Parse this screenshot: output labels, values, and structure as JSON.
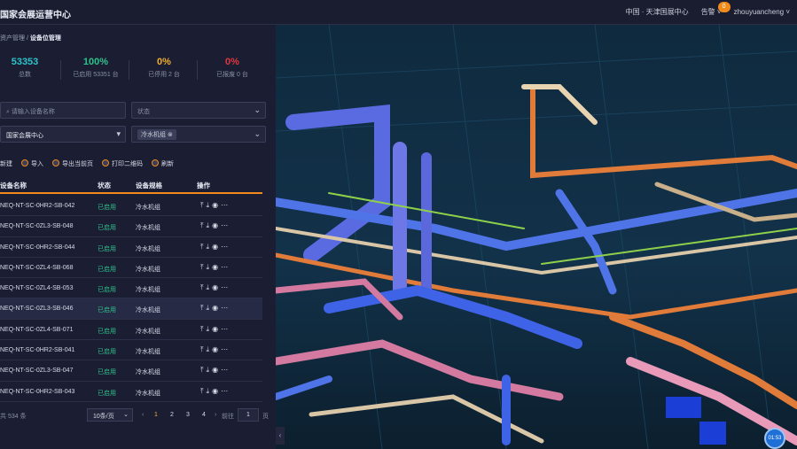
{
  "header": {
    "title": "国家会展运营中心",
    "region": "中国 · 天津国展中心",
    "alarm_label": "告警",
    "alarm_count": "0",
    "username": "zhouyuancheng"
  },
  "breadcrumb": {
    "parent": "资产管理",
    "current": "设备位管理"
  },
  "stats": [
    {
      "value": "53353",
      "label": "总数",
      "color": "#2ec2c8"
    },
    {
      "value": "100%",
      "label": "已启用 53351 台",
      "color": "#2ec28b"
    },
    {
      "value": "0%",
      "label": "已停用 2 台",
      "color": "#f0b02a"
    },
    {
      "value": "0%",
      "label": "已报废 0 台",
      "color": "#e0363a"
    }
  ],
  "filters": {
    "search_placeholder": "请输入设备名称",
    "status_placeholder": "状态",
    "location_value": "国家会展中心",
    "category_tag": "冷水机组"
  },
  "toolbar": {
    "create": "新建",
    "import": "导入",
    "export": "导出当前页",
    "print_qr": "打印二维码",
    "refresh": "刷新"
  },
  "table": {
    "headers": [
      "设备名称",
      "状态",
      "设备规格",
      "操作"
    ],
    "rows": [
      {
        "name": "NEQ-NT-SC-0HR2-SB-042",
        "status": "已启用",
        "spec": "冷水机组"
      },
      {
        "name": "NEQ-NT-SC-0ZL3-SB-048",
        "status": "已启用",
        "spec": "冷水机组"
      },
      {
        "name": "NEQ-NT-SC-0HR2-SB-044",
        "status": "已启用",
        "spec": "冷水机组"
      },
      {
        "name": "NEQ-NT-SC-0ZL4-SB-068",
        "status": "已启用",
        "spec": "冷水机组"
      },
      {
        "name": "NEQ-NT-SC-0ZL4-SB-053",
        "status": "已启用",
        "spec": "冷水机组"
      },
      {
        "name": "NEQ-NT-SC-0ZL3-SB-046",
        "status": "已启用",
        "spec": "冷水机组"
      },
      {
        "name": "NEQ-NT-SC-0ZL4-SB-071",
        "status": "已启用",
        "spec": "冷水机组"
      },
      {
        "name": "NEQ-NT-SC-0HR2-SB-041",
        "status": "已启用",
        "spec": "冷水机组"
      },
      {
        "name": "NEQ-NT-SC-0ZL3-SB-047",
        "status": "已启用",
        "spec": "冷水机组"
      },
      {
        "name": "NEQ-NT-SC-0HR2-SB-043",
        "status": "已启用",
        "spec": "冷水机组"
      }
    ],
    "action_icons": [
      "upload-icon",
      "download-icon",
      "view-icon",
      "more-icon"
    ],
    "selected_row_index": 5
  },
  "pagination": {
    "total": "共 534 条",
    "page_size": "10条/页",
    "pages": [
      "1",
      "2",
      "3",
      "4"
    ],
    "current_page": "1",
    "goto_label": "前往",
    "goto_value": "1",
    "page_suffix": "页"
  },
  "scene": {
    "fab_label": "01:53"
  }
}
